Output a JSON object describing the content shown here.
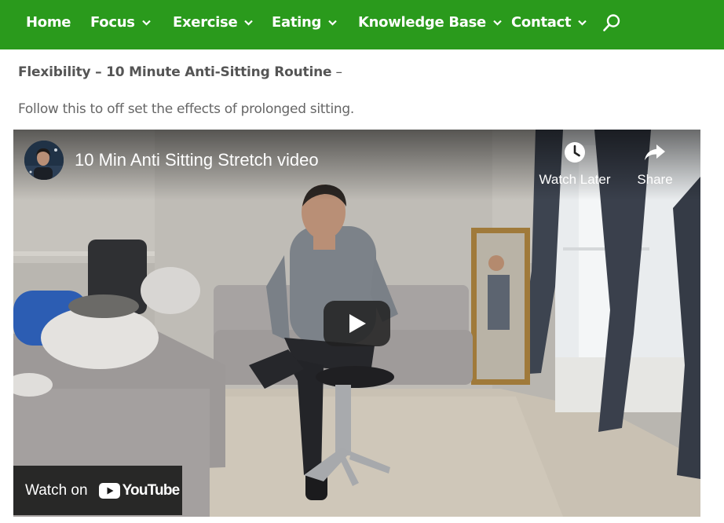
{
  "nav": {
    "items": [
      {
        "label": "Home",
        "has_dropdown": false
      },
      {
        "label": "Focus",
        "has_dropdown": true
      },
      {
        "label": "Exercise",
        "has_dropdown": true
      },
      {
        "label": "Eating",
        "has_dropdown": true
      },
      {
        "label": "Knowledge Base",
        "has_dropdown": true
      },
      {
        "label": "Contact",
        "has_dropdown": true
      }
    ],
    "search_icon": "search-icon",
    "background_color": "#2a9a1c"
  },
  "content": {
    "heading_bold": "Flexibility – 10 Minute Anti-Sitting Routine",
    "heading_suffix": " –",
    "subtext": "Follow this to off set the effects of prolonged sitting."
  },
  "video": {
    "title": "10 Min Anti Sitting Stretch video",
    "watch_later_label": "Watch Later",
    "share_label": "Share",
    "watch_on_label": "Watch on",
    "youtube_label": "YouTube",
    "play_icon": "play-icon",
    "youtube_red": "#ff0000"
  }
}
